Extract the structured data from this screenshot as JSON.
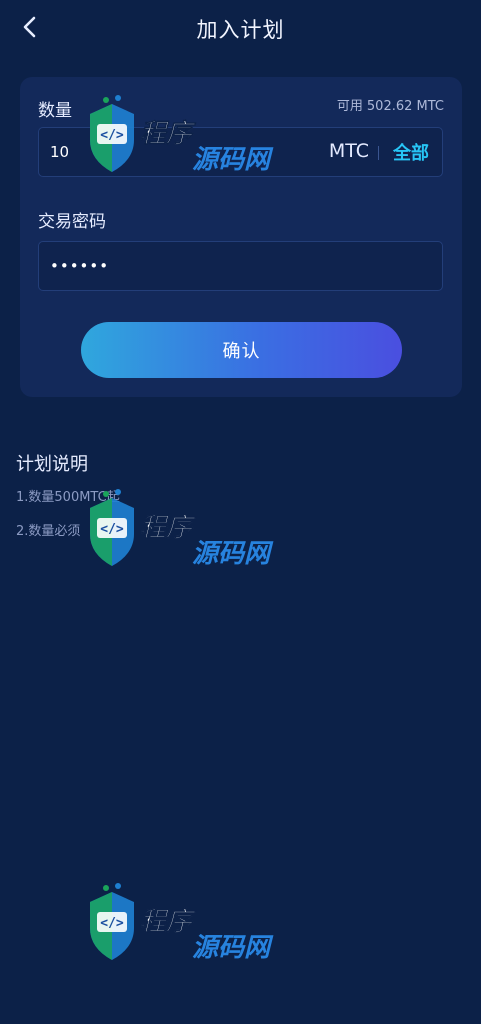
{
  "header": {
    "title": "加入计划",
    "back_icon": "chevron-left-icon"
  },
  "form": {
    "quantity_label": "数量",
    "available_label": "可用",
    "available_value": "502.62 MTC",
    "quantity_value": "10",
    "unit": "MTC",
    "all_label": "全部",
    "password_label": "交易密码",
    "password_value": "••••••",
    "confirm_label": "确认"
  },
  "notes": {
    "title": "计划说明",
    "items": [
      "1.数量500MTC起",
      "2.数量必须"
    ]
  },
  "watermark": {
    "text": "程序源码网",
    "icon": "code-shield-logo"
  },
  "colors": {
    "background": "#0c2148",
    "card": "#13295a",
    "accent": "#27c5f6",
    "button_start": "#2fa7dd",
    "button_end": "#4a4fe0"
  }
}
